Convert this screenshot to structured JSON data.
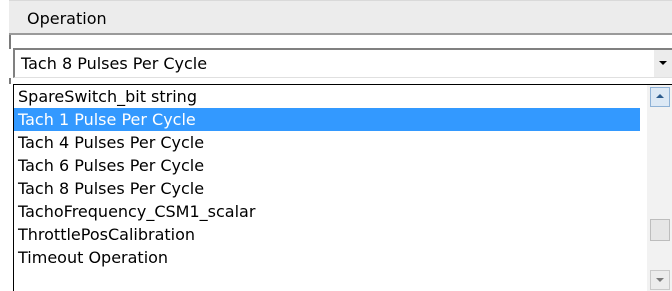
{
  "header": {
    "label": "Operation"
  },
  "combo": {
    "selected_value": "Tach 8 Pulses Per Cycle"
  },
  "dropdown": {
    "items": [
      {
        "label": "SpareSwitch_bit string",
        "selected": false
      },
      {
        "label": "Tach 1 Pulse Per Cycle",
        "selected": true
      },
      {
        "label": "Tach 4 Pulses Per Cycle",
        "selected": false
      },
      {
        "label": "Tach 6 Pulses Per Cycle",
        "selected": false
      },
      {
        "label": "Tach 8 Pulses Per Cycle",
        "selected": false
      },
      {
        "label": "TachoFrequency_CSM1_scalar",
        "selected": false
      },
      {
        "label": "ThrottlePosCalibration",
        "selected": false
      },
      {
        "label": "Timeout Operation",
        "selected": false
      }
    ]
  },
  "colors": {
    "selection": "#3399ff",
    "header_bg": "#ececec"
  }
}
